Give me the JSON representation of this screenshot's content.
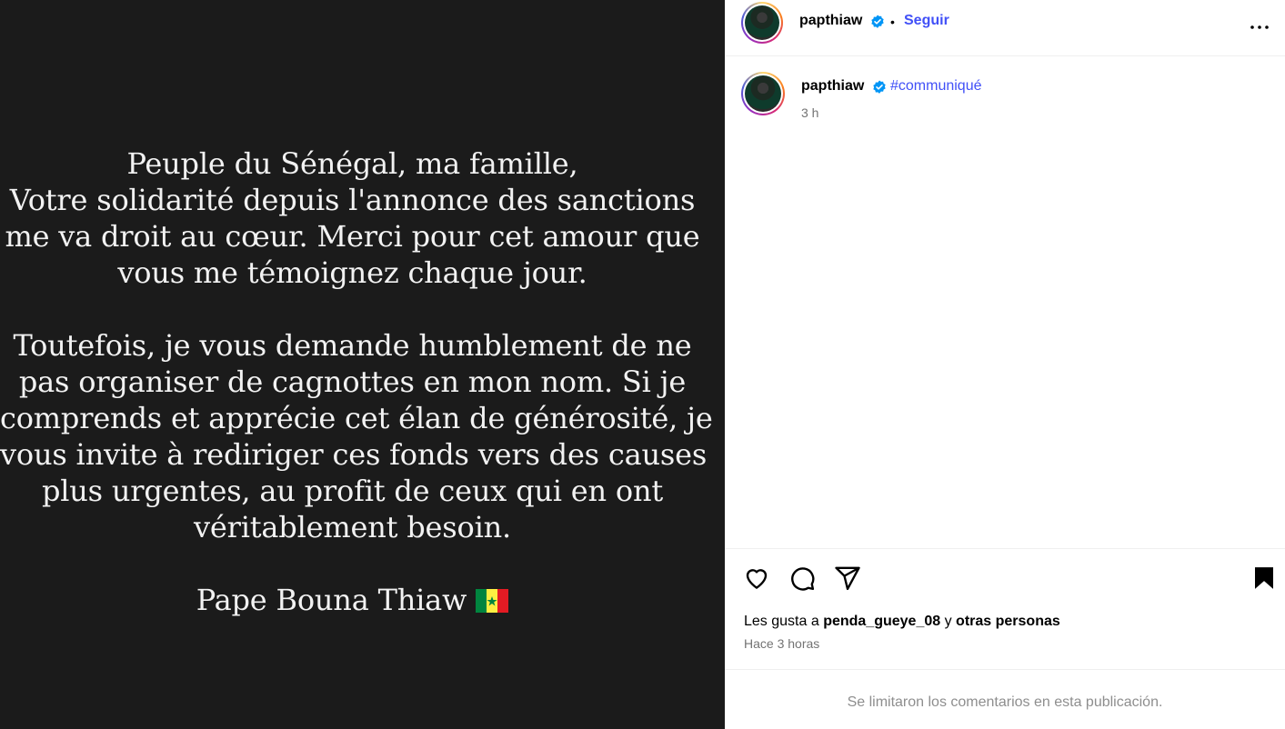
{
  "post_image": {
    "paragraphs": [
      [
        "Peuple du Sénégal, ma famille,",
        "Votre solidarité depuis l'annonce des sanctions",
        "me va droit au cœur. Merci pour cet amour que",
        "vous me témoignez chaque jour."
      ],
      [
        "Toutefois, je vous demande humblement de ne",
        "pas organiser de cagnottes en mon nom. Si je",
        "comprends et apprécie cet élan de générosité, je",
        "vous invite à rediriger ces fonds vers des causes",
        "plus urgentes, au profit de ceux qui en ont",
        "véritablement besoin."
      ]
    ],
    "signature": "Pape Bouna Thiaw",
    "signature_emoji": "senegal-flag",
    "background_color": "#1b1b1b",
    "text_color": "#f2f2f2"
  },
  "header": {
    "username": "papthiaw",
    "separator": "•",
    "follow_label": "Seguir",
    "more_icon": "more-horizontal-icon"
  },
  "caption": {
    "username": "papthiaw",
    "text": "#communiqué",
    "time": "3 h"
  },
  "actions": {
    "icons": [
      "heart-icon",
      "comment-icon",
      "share-icon",
      "bookmark-icon"
    ]
  },
  "likes": {
    "prefix": "Les gusta a",
    "user": "penda_gueye_08",
    "joiner": "y",
    "others": "otras personas"
  },
  "posted_time": "Hace 3 horas",
  "comments_notice": "Se limitaron los comentarios en esta publicación.",
  "colors": {
    "link_blue": "#4150f7",
    "verified_blue": "#0095f6",
    "muted": "#737373"
  }
}
